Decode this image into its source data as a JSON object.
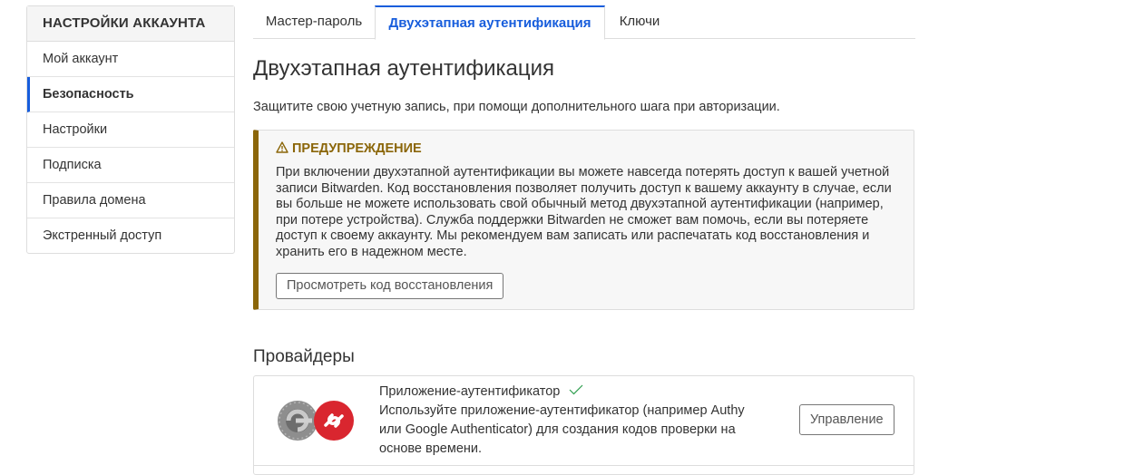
{
  "sidebar": {
    "header": "НАСТРОЙКИ АККАУНТА",
    "items": [
      {
        "label": "Мой аккаунт"
      },
      {
        "label": "Безопасность",
        "active": true
      },
      {
        "label": "Настройки"
      },
      {
        "label": "Подписка"
      },
      {
        "label": "Правила домена"
      },
      {
        "label": "Экстренный доступ"
      }
    ]
  },
  "tabs": [
    {
      "label": "Мастер-пароль"
    },
    {
      "label": "Двухэтапная аутентификация",
      "active": true
    },
    {
      "label": "Ключи"
    }
  ],
  "main": {
    "title": "Двухэтапная аутентификация",
    "description": "Защитите свою учетную запись, при помощи дополнительного шага при авторизации."
  },
  "warning": {
    "icon": "warning-triangle-icon",
    "title": "ПРЕДУПРЕЖДЕНИЕ",
    "text": "При включении двухэтапной аутентификации вы можете навсегда потерять доступ к вашей учетной записи Bitwarden. Код восстановления позволяет получить доступ к вашему аккаунту в случае, если вы больше не можете использовать свой обычный метод двухэтапной аутентификации (например, при потере устройства). Служба поддержки Bitwarden не сможет вам помочь, если вы потеряете доступ к своему аккаунту. Мы рекомендуем вам записать или распечатать код восстановления и хранить его в надежном месте.",
    "button": "Просмотреть код восстановления"
  },
  "providers": {
    "title": "Провайдеры",
    "items": [
      {
        "name": "Приложение-аутентификатор",
        "enabled_icon": "check-icon",
        "description": "Используйте приложение-аутентификатор (например Authy или Google Authenticator) для создания кодов проверки на основе времени.",
        "button": "Управление"
      }
    ]
  },
  "colors": {
    "accent": "#175ddc",
    "warning": "#8b6609",
    "success": "#2f9e4f"
  }
}
